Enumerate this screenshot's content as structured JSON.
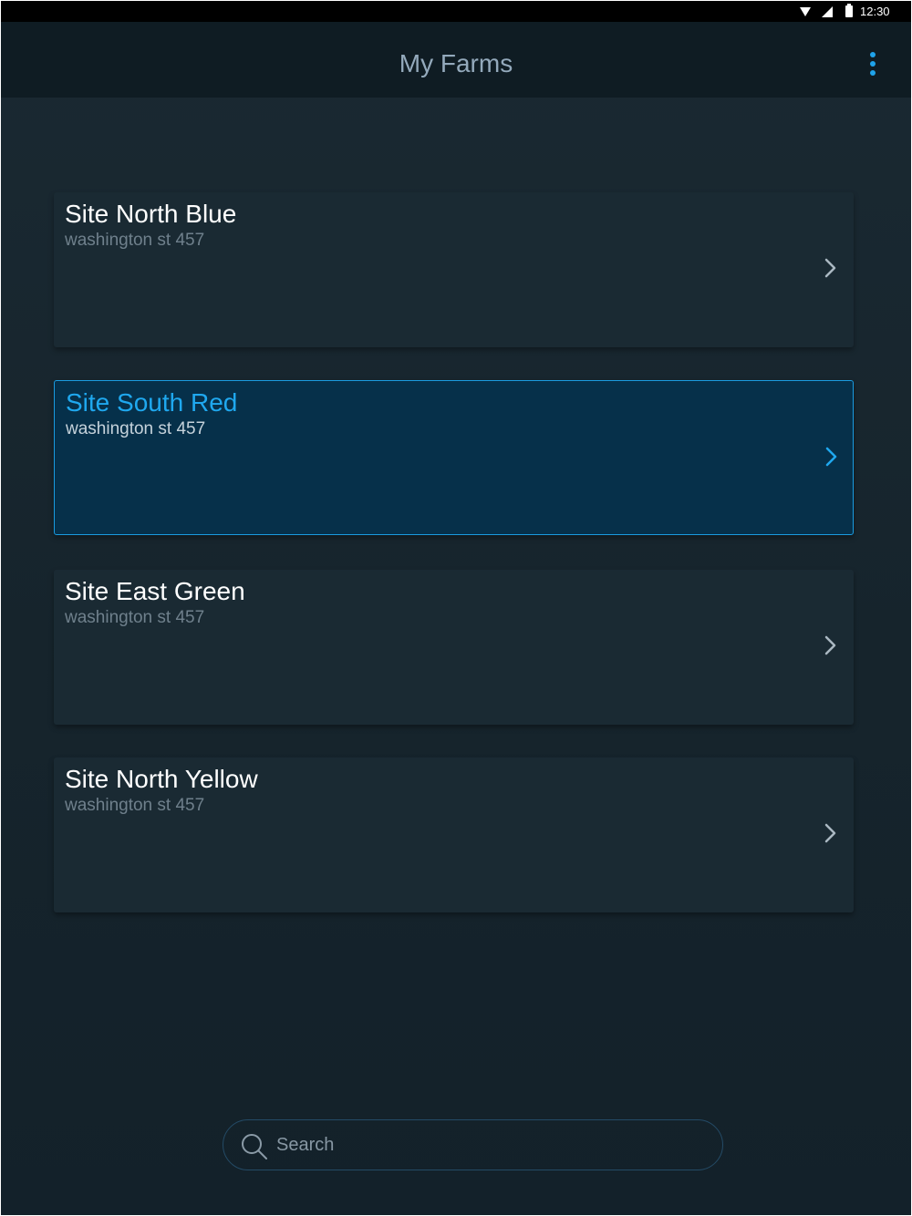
{
  "status_bar": {
    "time": "12:30",
    "icons": [
      "wifi-icon",
      "signal-icon",
      "battery-icon"
    ]
  },
  "app_bar": {
    "title": "My Farms",
    "menu_icon": "more-vert-icon"
  },
  "farms": [
    {
      "name": "Site North Blue",
      "address": "washington st 457",
      "selected": false
    },
    {
      "name": "Site South Red",
      "address": "washington st 457",
      "selected": true
    },
    {
      "name": "Site East Green",
      "address": "washington st 457",
      "selected": false
    },
    {
      "name": "Site North Yellow",
      "address": "washington st 457",
      "selected": false
    }
  ],
  "search": {
    "placeholder": "Search",
    "value": ""
  },
  "colors": {
    "accent": "#1fa3ea",
    "background": "#16242c",
    "card": "#1a2a33",
    "card_selected": "#06304a",
    "title": "#93a9bb"
  }
}
